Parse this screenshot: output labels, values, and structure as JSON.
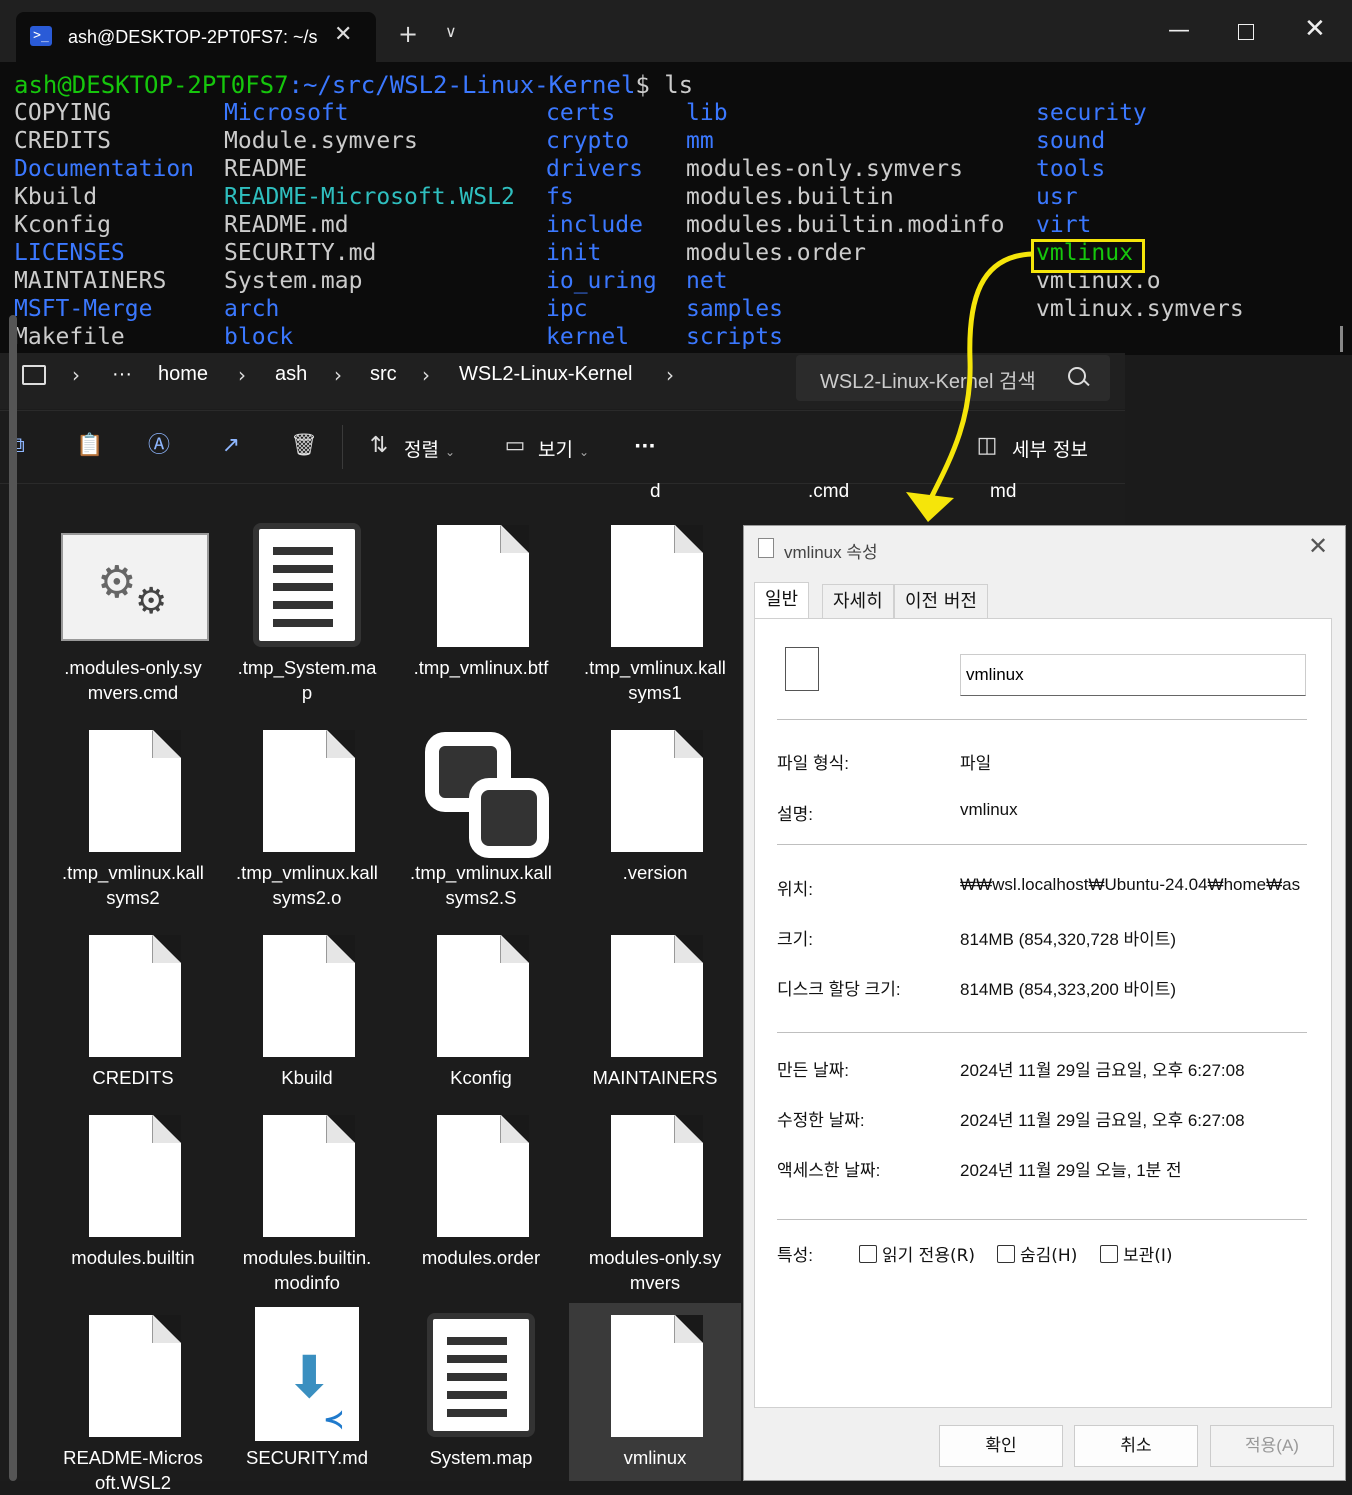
{
  "terminal": {
    "tab_title": "ash@DESKTOP-2PT0FS7: ~/src",
    "tab_icon": ">_",
    "new_tab": "+",
    "dropdown": "⌄",
    "prompt_user": "ash@DESKTOP-2PT0FS7",
    "prompt_path": ":~/src/WSL2-Linux-Kernel",
    "prompt_cmd": "$ ls",
    "columns": [
      [
        [
          "COPYING",
          "plain"
        ],
        [
          "CREDITS",
          "plain"
        ],
        [
          "Documentation",
          "dir"
        ],
        [
          "Kbuild",
          "plain"
        ],
        [
          "Kconfig",
          "plain"
        ],
        [
          "LICENSES",
          "dir"
        ],
        [
          "MAINTAINERS",
          "plain"
        ],
        [
          "MSFT-Merge",
          "dir"
        ],
        [
          "Makefile",
          "plain"
        ]
      ],
      [
        [
          "Microsoft",
          "dir"
        ],
        [
          "Module.symvers",
          "plain"
        ],
        [
          "README",
          "plain"
        ],
        [
          "README-Microsoft.WSL2",
          "cyan"
        ],
        [
          "README.md",
          "plain"
        ],
        [
          "SECURITY.md",
          "plain"
        ],
        [
          "System.map",
          "plain"
        ],
        [
          "arch",
          "dir"
        ],
        [
          "block",
          "dir"
        ]
      ],
      [
        [
          "certs",
          "dir"
        ],
        [
          "crypto",
          "dir"
        ],
        [
          "drivers",
          "dir"
        ],
        [
          "fs",
          "dir"
        ],
        [
          "include",
          "dir"
        ],
        [
          "init",
          "dir"
        ],
        [
          "io_uring",
          "dir"
        ],
        [
          "ipc",
          "dir"
        ],
        [
          "kernel",
          "dir"
        ]
      ],
      [
        [
          "lib",
          "dir"
        ],
        [
          "mm",
          "dir"
        ],
        [
          "modules-only.symvers",
          "plain"
        ],
        [
          "modules.builtin",
          "plain"
        ],
        [
          "modules.builtin.modinfo",
          "plain"
        ],
        [
          "modules.order",
          "plain"
        ],
        [
          "net",
          "dir"
        ],
        [
          "samples",
          "dir"
        ],
        [
          "scripts",
          "dir"
        ]
      ],
      [
        [
          "security",
          "dir"
        ],
        [
          "sound",
          "dir"
        ],
        [
          "tools",
          "dir"
        ],
        [
          "usr",
          "dir"
        ],
        [
          "virt",
          "dir"
        ],
        [
          "vmlinux",
          "exe"
        ],
        [
          "vmlinux.o",
          "plain"
        ],
        [
          "vmlinux.symvers",
          "plain"
        ]
      ]
    ]
  },
  "explorer": {
    "breadcrumb": [
      "home",
      "ash",
      "src",
      "WSL2-Linux-Kernel"
    ],
    "ellipsis": "···",
    "search_placeholder": "WSL2-Linux-Kernel 검색",
    "toolbar": {
      "sort": "정렬",
      "view": "보기",
      "more": "···",
      "details": "세부 정보"
    },
    "partial_labels": [
      "d",
      ".cmd",
      "md"
    ],
    "files": [
      {
        "label": ".modules-only.sy\nmvers.cmd",
        "icon": "settings-file-icon"
      },
      {
        "label": ".tmp_System.ma\np",
        "icon": "text-document-icon"
      },
      {
        "label": ".tmp_vmlinux.btf",
        "icon": "blank-file-icon"
      },
      {
        "label": ".tmp_vmlinux.kall\nsyms1",
        "icon": "blank-file-icon"
      },
      {
        "label": ".tmp_vmlinux.kall\nsyms2",
        "icon": "blank-file-icon"
      },
      {
        "label": ".tmp_vmlinux.kall\nsyms2.o",
        "icon": "blank-file-icon"
      },
      {
        "label": ".tmp_vmlinux.kall\nsyms2.S",
        "icon": "assembly-file-icon"
      },
      {
        "label": ".version",
        "icon": "blank-file-icon"
      },
      {
        "label": "CREDITS",
        "icon": "blank-file-icon"
      },
      {
        "label": "Kbuild",
        "icon": "blank-file-icon"
      },
      {
        "label": "Kconfig",
        "icon": "blank-file-icon"
      },
      {
        "label": "MAINTAINERS",
        "icon": "blank-file-icon"
      },
      {
        "label": "modules.builtin",
        "icon": "blank-file-icon"
      },
      {
        "label": "modules.builtin.\nmodinfo",
        "icon": "blank-file-icon"
      },
      {
        "label": "modules.order",
        "icon": "blank-file-icon"
      },
      {
        "label": "modules-only.sy\nmvers",
        "icon": "blank-file-icon"
      },
      {
        "label": "README-Micros\noft.WSL2",
        "icon": "blank-file-icon"
      },
      {
        "label": "SECURITY.md",
        "icon": "vscode-markdown-icon"
      },
      {
        "label": "System.map",
        "icon": "text-document-icon"
      },
      {
        "label": "vmlinux",
        "icon": "blank-file-icon",
        "selected": true
      }
    ]
  },
  "dialog": {
    "title": "vmlinux 속성",
    "tabs": [
      "일반",
      "자세히",
      "이전 버전"
    ],
    "name": "vmlinux",
    "rows": [
      {
        "label": "파일 형식:",
        "value": "파일"
      },
      {
        "label": "설명:",
        "value": "vmlinux"
      },
      {
        "label": "위치:",
        "value": "₩₩wsl.localhost₩Ubuntu-24.04₩home₩as"
      },
      {
        "label": "크기:",
        "value": "814MB (854,320,728 바이트)"
      },
      {
        "label": "디스크 할당 크기:",
        "value": "814MB (854,323,200 바이트)"
      },
      {
        "label": "만든 날짜:",
        "value": "2024년 11월 29일 금요일, 오후 6:27:08"
      },
      {
        "label": "수정한 날짜:",
        "value": "2024년 11월 29일 금요일, 오후 6:27:08"
      },
      {
        "label": "액세스한 날짜:",
        "value": "2024년 11월 29일 오늘, 1분 전"
      }
    ],
    "attr_label": "특성:",
    "attrs": [
      "읽기 전용(R)",
      "숨김(H)",
      "보관(I)"
    ],
    "buttons": {
      "ok": "확인",
      "cancel": "취소",
      "apply": "적용(A)"
    }
  },
  "colors": {
    "annotation": "#f5e50a",
    "terminal_dir": "#3b78ff",
    "terminal_exe": "#16c60c"
  }
}
